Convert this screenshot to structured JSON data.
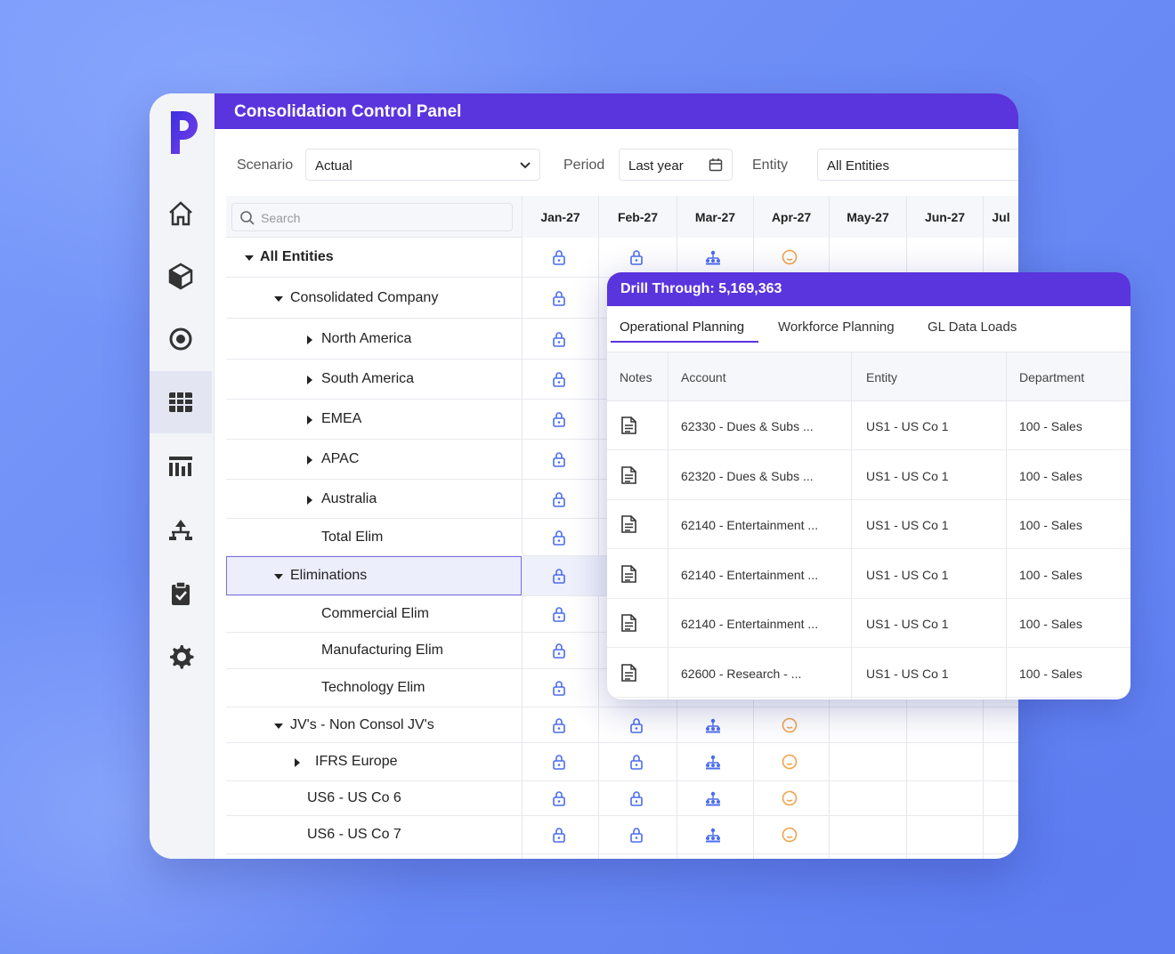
{
  "app": {
    "title": "Consolidation Control Panel"
  },
  "sidebar": {
    "logo_letter": "P",
    "items": [
      {
        "icon": "home-icon"
      },
      {
        "icon": "cube-icon"
      },
      {
        "icon": "target-icon"
      },
      {
        "icon": "grid-icon",
        "active": true
      },
      {
        "icon": "report-icon"
      },
      {
        "icon": "hierarchy-icon"
      },
      {
        "icon": "clipboard-check-icon"
      },
      {
        "icon": "gear-icon"
      }
    ]
  },
  "filters": {
    "scenario_label": "Scenario",
    "scenario_value": "Actual",
    "period_label": "Period",
    "period_value": "Last year",
    "entity_label": "Entity",
    "entity_value": "All Entities"
  },
  "grid": {
    "search_placeholder": "Search",
    "columns": [
      "Jan-27",
      "Feb-27",
      "Mar-27",
      "Apr-27",
      "May-27",
      "Jun-27",
      "Jul"
    ],
    "rows": [
      {
        "label": "All Entities",
        "level": 0,
        "toggle": "open",
        "bold": true,
        "icons": [
          "lock",
          "lock",
          "org",
          "clock"
        ]
      },
      {
        "label": "Consolidated Company",
        "level": 1,
        "toggle": "open",
        "icons": [
          "lock"
        ]
      },
      {
        "label": "North America",
        "level": 2,
        "toggle": "closed",
        "icons": [
          "lock"
        ]
      },
      {
        "label": "South America",
        "level": 2,
        "toggle": "closed",
        "icons": [
          "lock"
        ]
      },
      {
        "label": "EMEA",
        "level": 2,
        "toggle": "closed",
        "icons": [
          "lock"
        ]
      },
      {
        "label": "APAC",
        "level": 2,
        "toggle": "closed",
        "icons": [
          "lock"
        ]
      },
      {
        "label": "Australia",
        "level": 2,
        "toggle": "closed",
        "icons": [
          "lock"
        ]
      },
      {
        "label": "Total Elim",
        "level": 2,
        "toggle": "none",
        "icons": [
          "lock"
        ]
      },
      {
        "label": "Eliminations",
        "level": 1,
        "toggle": "open",
        "selected": true,
        "icons": [
          "lock"
        ]
      },
      {
        "label": "Commercial Elim",
        "level": 2,
        "toggle": "none",
        "icons": [
          "lock"
        ]
      },
      {
        "label": "Manufacturing Elim",
        "level": 2,
        "toggle": "none",
        "icons": [
          "lock"
        ]
      },
      {
        "label": "Technology Elim",
        "level": 2,
        "toggle": "none",
        "icons": [
          "lock"
        ]
      },
      {
        "label": "JV's - Non Consol JV's",
        "level": 1,
        "toggle": "open",
        "icons": [
          "lock",
          "lock",
          "org",
          "clock"
        ]
      },
      {
        "label": "IFRS Europe",
        "level": 1.6,
        "toggle": "closed",
        "icons": [
          "lock",
          "lock",
          "org",
          "clock"
        ]
      },
      {
        "label": "US6 - US Co 6",
        "level": 1.6,
        "toggle": "none",
        "icons": [
          "lock",
          "lock",
          "org",
          "clock"
        ]
      },
      {
        "label": "US6 - US Co 7",
        "level": 1.6,
        "toggle": "none",
        "icons": [
          "lock",
          "lock",
          "org",
          "clock"
        ]
      }
    ]
  },
  "drill": {
    "title": "Drill Through: 5,169,363",
    "tabs": [
      "Operational Planning",
      "Workforce Planning",
      "GL Data Loads"
    ],
    "headers": [
      "Notes",
      "Account",
      "Entity",
      "Department"
    ],
    "rows": [
      {
        "account": "62330 - Dues & Subs ...",
        "entity": "US1 - US Co 1",
        "department": "100 - Sales"
      },
      {
        "account": "62320 - Dues & Subs ...",
        "entity": "US1 - US Co 1",
        "department": "100 - Sales"
      },
      {
        "account": "62140 - Entertainment ...",
        "entity": "US1 - US Co 1",
        "department": "100 - Sales"
      },
      {
        "account": "62140 - Entertainment ...",
        "entity": "US1 - US Co 1",
        "department": "100 - Sales"
      },
      {
        "account": "62140 - Entertainment ...",
        "entity": "US1 - US Co 1",
        "department": "100 - Sales"
      },
      {
        "account": "62600 - Research - ...",
        "entity": "US1 - US Co 1",
        "department": "100 - Sales"
      }
    ]
  },
  "colors": {
    "brand": "#5a34dc",
    "icon_blue": "#4a6cf0",
    "icon_orange": "#f2a24a"
  }
}
